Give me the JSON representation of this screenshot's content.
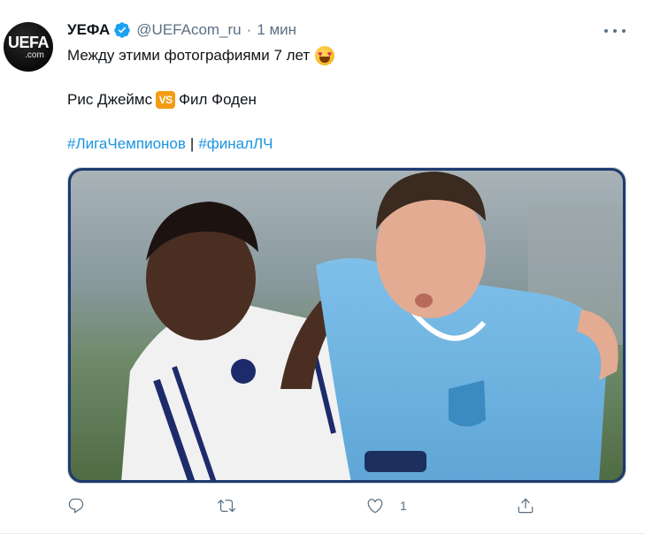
{
  "tweet": {
    "author_name": "УЕФА",
    "handle": "@UEFAcom_ru",
    "separator": "·",
    "time": "1 мин",
    "line1": "Между этими фотографиями 7 лет",
    "player1": "Рис Джеймс",
    "vs_label": "VS",
    "player2": "Фил Фоден",
    "hashtag1": "#ЛигаЧемпионов",
    "pipe": "|",
    "hashtag2": "#финалЛЧ",
    "avatar_logo_main": "UEFA",
    "avatar_logo_sub": ".com"
  },
  "actions": {
    "like_count": "1"
  },
  "icons": {
    "verified": "verified-badge-icon",
    "more": "more-horizontal-icon",
    "reply": "reply-icon",
    "retweet": "retweet-icon",
    "like": "heart-icon",
    "share": "share-icon"
  },
  "colors": {
    "link": "#1b95e0",
    "secondary_text": "#5b7083",
    "verified": "#1da1f2",
    "vs_badge": "#f39c12"
  }
}
